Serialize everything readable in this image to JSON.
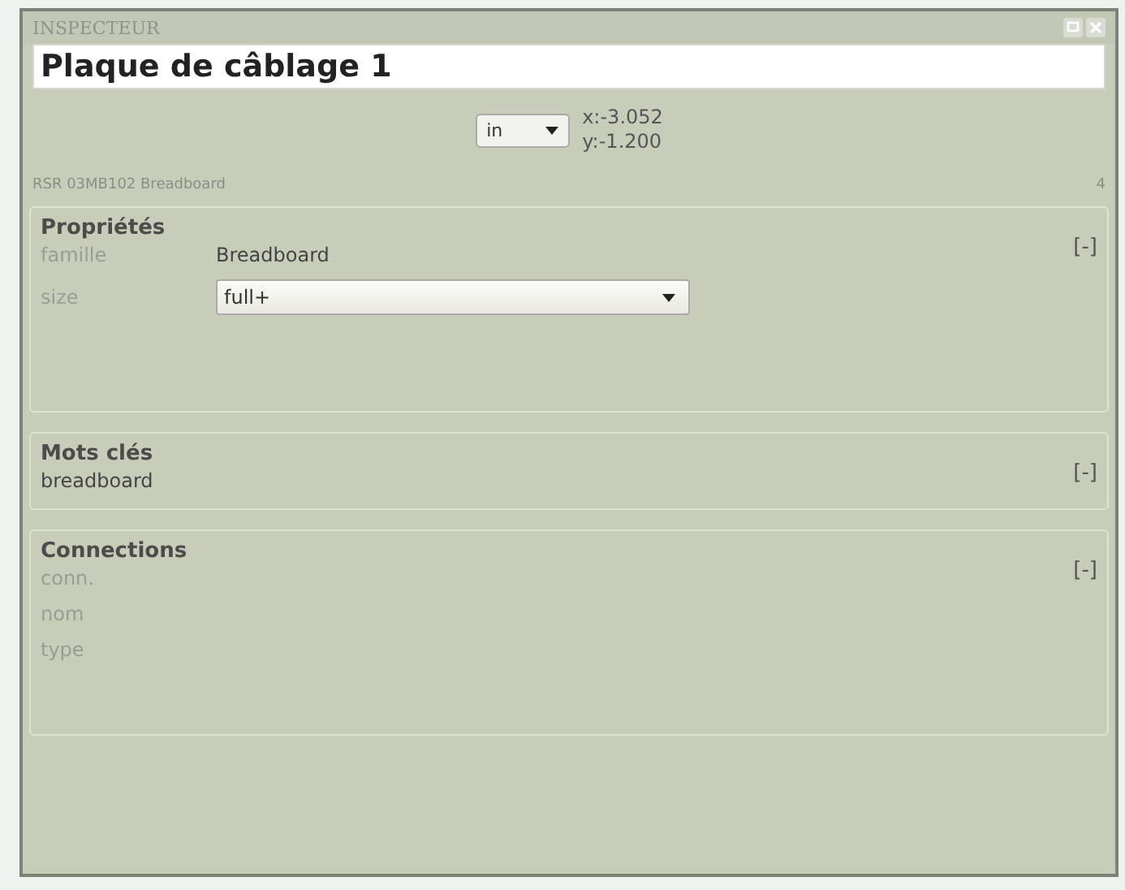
{
  "window": {
    "title": "INSPECTEUR"
  },
  "name_field": {
    "value": "Plaque de câblage 1"
  },
  "units": {
    "value": "in",
    "x": "x:-3.052",
    "y": "y:-1.200"
  },
  "part_info": {
    "description": "RSR 03MB102 Breadboard",
    "count": "4"
  },
  "sections": [
    {
      "title": "Propriétés",
      "toggle": "[-]",
      "rows": [
        {
          "label": "famille",
          "kind": "text",
          "value": "Breadboard"
        },
        {
          "label": "size",
          "kind": "select",
          "value": "full+"
        }
      ]
    },
    {
      "title": "Mots clés",
      "toggle": "[-]",
      "rows": [
        {
          "kind": "text",
          "value": "breadboard"
        }
      ]
    },
    {
      "title": "Connections",
      "toggle": "[-]",
      "rows": [
        {
          "label": "conn.",
          "kind": "label"
        },
        {
          "label": "nom",
          "kind": "label"
        },
        {
          "label": "type",
          "kind": "label"
        }
      ]
    }
  ]
}
